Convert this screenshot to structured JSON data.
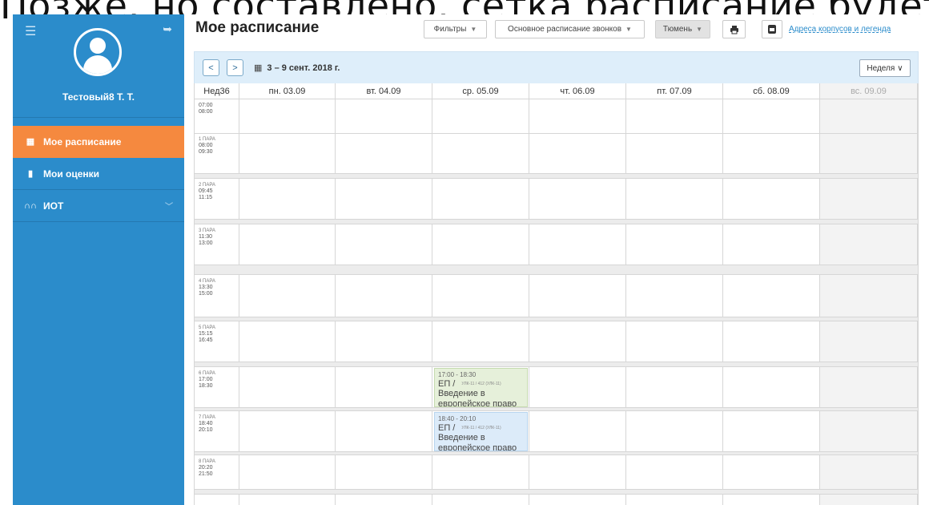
{
  "slide": {
    "overlay_text": "Позже, но составлено, сетка расписание будет"
  },
  "sidebar": {
    "menu_icon": "hamburger-icon",
    "logout_icon": "logout-icon",
    "username": "Тестовый8 Т. Т.",
    "items": [
      {
        "label": "Мое расписание",
        "icon": "calendar-icon",
        "active": true
      },
      {
        "label": "Мои оценки",
        "icon": "bookmark-icon",
        "active": false
      },
      {
        "label": "ИОТ",
        "icon": "binoculars-icon",
        "active": false,
        "has_chevron": true
      }
    ]
  },
  "header": {
    "title": "Мое расписание",
    "filters": "Фильтры",
    "schedule_type": "Основное расписание звонков",
    "city": "Тюмень",
    "print_icon": "print-icon",
    "ics_icon": "ics-export-icon",
    "link": "Адреса корпусов и легенда"
  },
  "calendar": {
    "prev_icon": "chevron-left-icon",
    "next_icon": "chevron-right-icon",
    "range": "3 – 9 сент. 2018 г.",
    "view": "Неделя",
    "week_label": "Нед36",
    "days": [
      "пн. 03.09",
      "вт. 04.09",
      "ср. 05.09",
      "чт. 06.09",
      "пт. 07.09",
      "сб. 08.09",
      "вс. 09.09"
    ],
    "slots": [
      {
        "pair": "",
        "start": "07:00",
        "end": "08:00"
      },
      {
        "pair": "1 ПАРА",
        "start": "08:00",
        "end": "09:30"
      },
      {
        "pair": "2 ПАРА",
        "start": "09:45",
        "end": "11:15"
      },
      {
        "pair": "3 ПАРА",
        "start": "11:30",
        "end": "13:00"
      },
      {
        "pair": "4 ПАРА",
        "start": "13:30",
        "end": "15:00"
      },
      {
        "pair": "5 ПАРА",
        "start": "15:15",
        "end": "16:45"
      },
      {
        "pair": "6 ПАРА",
        "start": "17:00",
        "end": "18:30"
      },
      {
        "pair": "7 ПАРА",
        "start": "18:40",
        "end": "20:10"
      },
      {
        "pair": "8 ПАРА",
        "start": "20:20",
        "end": "21:50"
      }
    ],
    "events": [
      {
        "time": "17:00 - 18:30",
        "type": "ЕП /",
        "room": "УЛК-11 / 412 (УЛК-11)",
        "name": "Введение в европейское право",
        "color": "green"
      },
      {
        "time": "18:40 - 20:10",
        "type": "ЕП /",
        "room": "УЛК-11 / 412 (УЛК-11)",
        "name": "Введение в европейское право",
        "color": "blue"
      }
    ]
  },
  "colors": {
    "sidebar": "#2b8ccb",
    "active": "#f5893f",
    "calendar_bar": "#deeefa"
  }
}
